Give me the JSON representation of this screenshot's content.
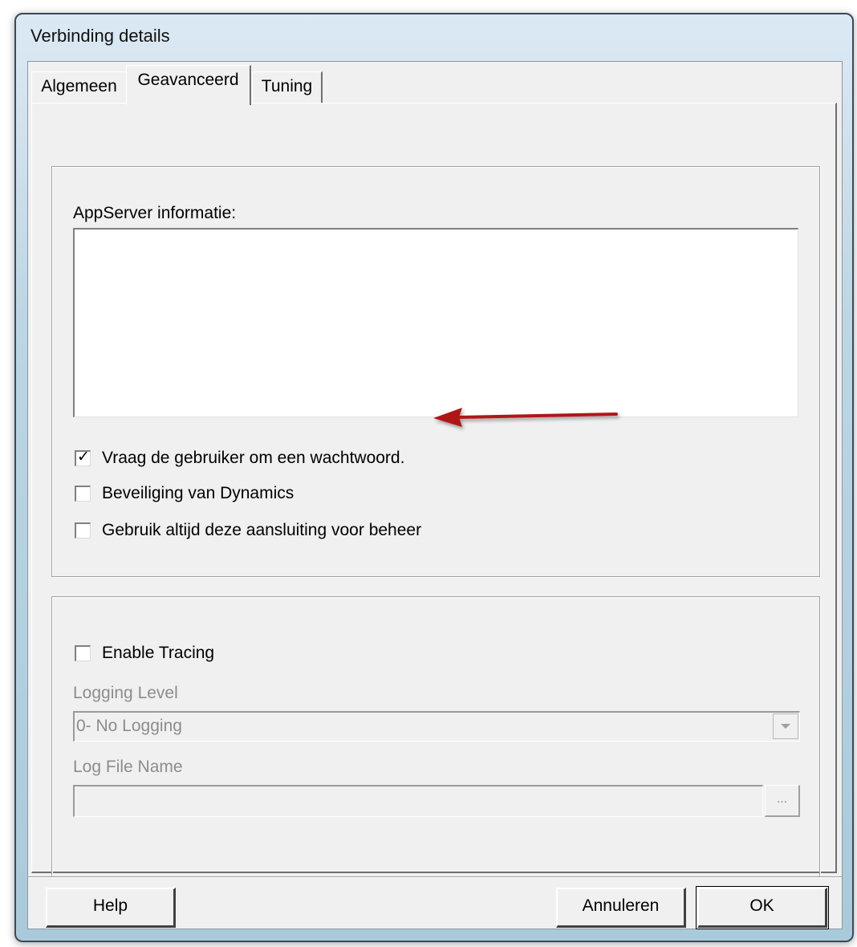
{
  "window": {
    "title": "Verbinding details"
  },
  "tabs": [
    {
      "label": "Algemeen",
      "selected": false
    },
    {
      "label": "Geavanceerd",
      "selected": true
    },
    {
      "label": "Tuning",
      "selected": false
    }
  ],
  "appserver": {
    "label": "AppServer informatie:",
    "value": ""
  },
  "checkboxes": [
    {
      "label": "Vraag de gebruiker om een wachtwoord.",
      "checked": true
    },
    {
      "label": "Beveiliging van Dynamics",
      "checked": false
    },
    {
      "label": "Gebruik altijd deze aansluiting voor beheer",
      "checked": false
    }
  ],
  "tracing": {
    "enable_label": "Enable Tracing",
    "enabled": false,
    "logging_level_label": "Logging Level",
    "logging_level_value": "0- No Logging",
    "log_file_label": "Log File Name",
    "log_file_value": "",
    "browse_label": "..."
  },
  "buttons": {
    "help": "Help",
    "cancel": "Annuleren",
    "ok": "OK"
  },
  "annotation": {
    "arrow_color": "#b01818"
  }
}
